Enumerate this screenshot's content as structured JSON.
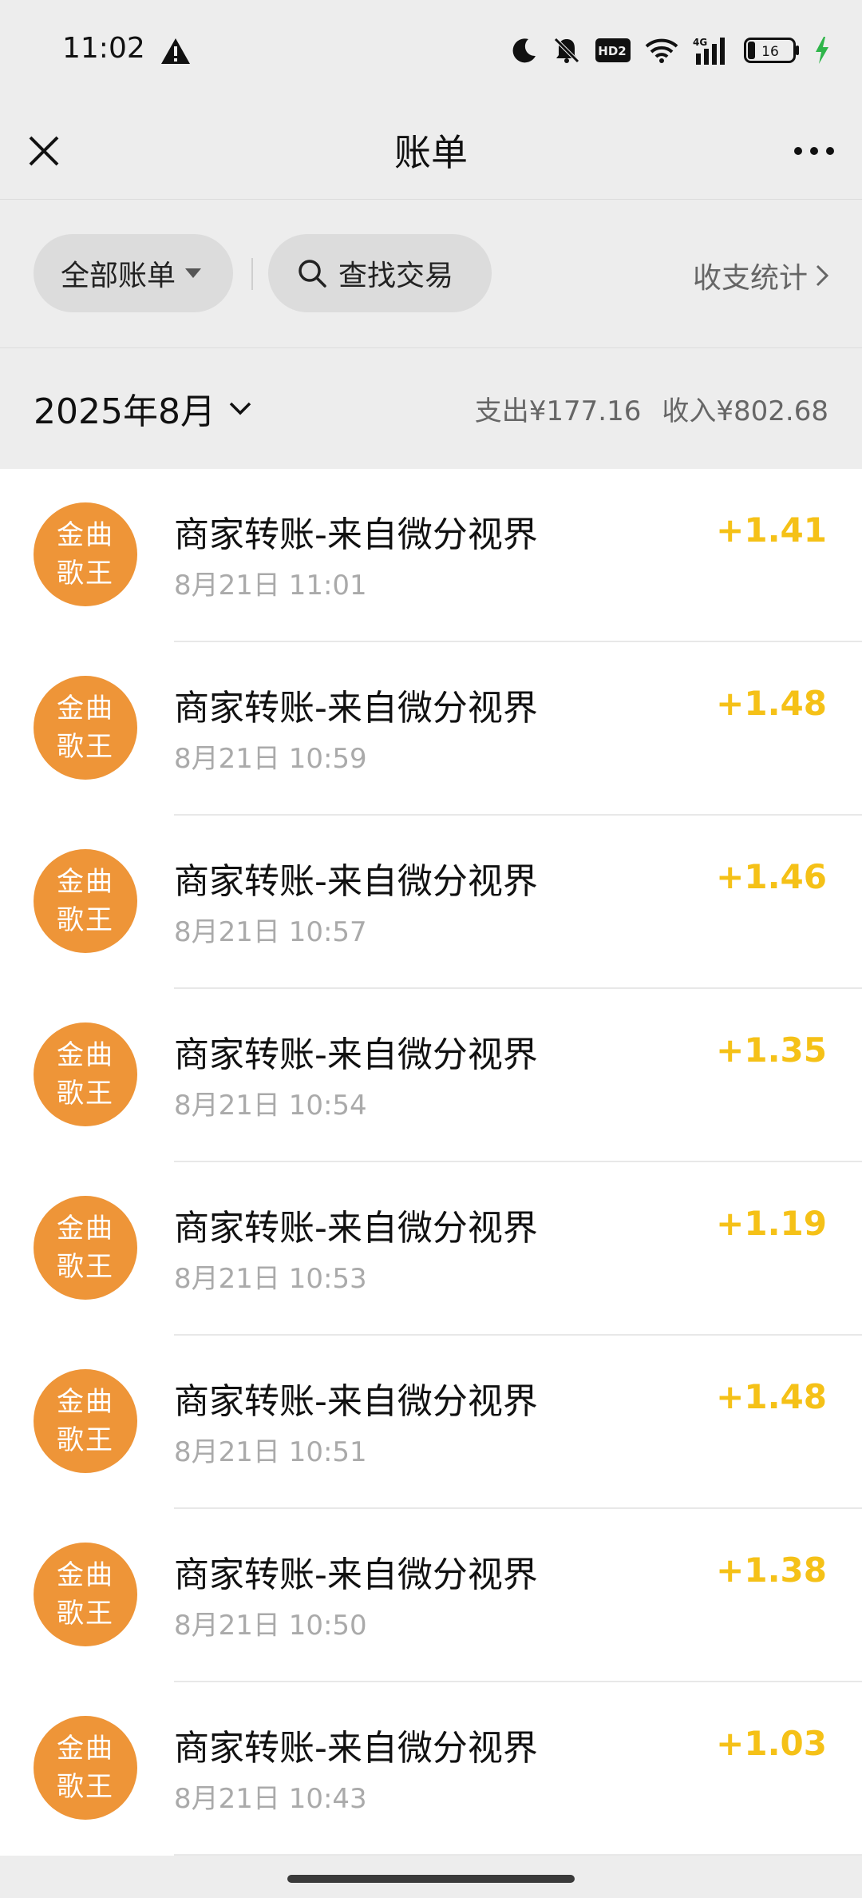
{
  "status": {
    "time": "11:02",
    "battery": "16",
    "network": "4G",
    "hd": "HD2"
  },
  "nav": {
    "title": "账单"
  },
  "filters": {
    "all_bills": "全部账单",
    "search": "查找交易",
    "stats": "收支统计"
  },
  "month": {
    "label": "2025年8月",
    "expense": "支出¥177.16",
    "income": "收入¥802.68"
  },
  "transactions": [
    {
      "avatar_line1": "金曲",
      "avatar_line2": "歌王",
      "title": "商家转账-来自微分视界",
      "time": "8月21日 11:01",
      "amount": "+1.41"
    },
    {
      "avatar_line1": "金曲",
      "avatar_line2": "歌王",
      "title": "商家转账-来自微分视界",
      "time": "8月21日 10:59",
      "amount": "+1.48"
    },
    {
      "avatar_line1": "金曲",
      "avatar_line2": "歌王",
      "title": "商家转账-来自微分视界",
      "time": "8月21日 10:57",
      "amount": "+1.46"
    },
    {
      "avatar_line1": "金曲",
      "avatar_line2": "歌王",
      "title": "商家转账-来自微分视界",
      "time": "8月21日 10:54",
      "amount": "+1.35"
    },
    {
      "avatar_line1": "金曲",
      "avatar_line2": "歌王",
      "title": "商家转账-来自微分视界",
      "time": "8月21日 10:53",
      "amount": "+1.19"
    },
    {
      "avatar_line1": "金曲",
      "avatar_line2": "歌王",
      "title": "商家转账-来自微分视界",
      "time": "8月21日 10:51",
      "amount": "+1.48"
    },
    {
      "avatar_line1": "金曲",
      "avatar_line2": "歌王",
      "title": "商家转账-来自微分视界",
      "time": "8月21日 10:50",
      "amount": "+1.38"
    },
    {
      "avatar_line1": "金曲",
      "avatar_line2": "歌王",
      "title": "商家转账-来自微分视界",
      "time": "8月21日 10:43",
      "amount": "+1.03"
    }
  ],
  "colors": {
    "income_amount": "#f5c117",
    "avatar_bg": "#ee9538",
    "background": "#ededed"
  }
}
